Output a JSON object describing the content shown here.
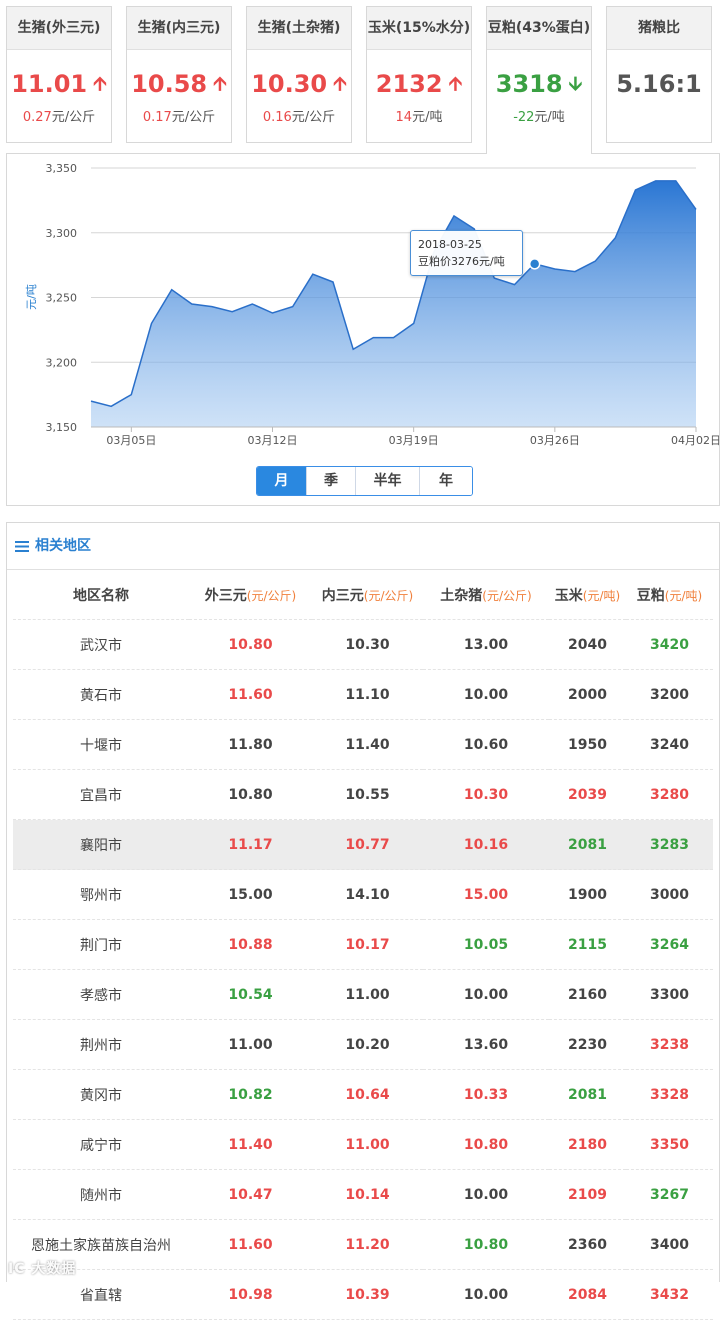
{
  "tabs": [
    {
      "title": "生猪(外三元)",
      "value": "11.01",
      "direction": "up",
      "change": "0.27",
      "unit": "元/公斤",
      "color": "red"
    },
    {
      "title": "生猪(内三元)",
      "value": "10.58",
      "direction": "up",
      "change": "0.17",
      "unit": "元/公斤",
      "color": "red"
    },
    {
      "title": "生猪(土杂猪)",
      "value": "10.30",
      "direction": "up",
      "change": "0.16",
      "unit": "元/公斤",
      "color": "red"
    },
    {
      "title": "玉米(15%水分)",
      "value": "2132",
      "direction": "up",
      "change": "14",
      "unit": "元/吨",
      "color": "red"
    },
    {
      "title": "豆粕(43%蛋白)",
      "value": "3318",
      "direction": "down",
      "change": "-22",
      "unit": "元/吨",
      "color": "green"
    },
    {
      "title": "猪粮比",
      "value": "5.16:1",
      "direction": "",
      "change": "",
      "unit": "",
      "color": "gray"
    }
  ],
  "active_tab": 4,
  "chart_data": {
    "type": "area",
    "ylabel": "元/吨",
    "ylim": [
      3150,
      3350
    ],
    "y_ticks": [
      "3,150",
      "3,200",
      "3,250",
      "3,300",
      "3,350"
    ],
    "x_ticks": [
      "03月05日",
      "03月12日",
      "03月19日",
      "03月26日",
      "04月02日"
    ],
    "x": [
      "2018-03-03",
      "2018-03-04",
      "2018-03-05",
      "2018-03-06",
      "2018-03-07",
      "2018-03-08",
      "2018-03-09",
      "2018-03-10",
      "2018-03-11",
      "2018-03-12",
      "2018-03-13",
      "2018-03-14",
      "2018-03-15",
      "2018-03-16",
      "2018-03-17",
      "2018-03-18",
      "2018-03-19",
      "2018-03-20",
      "2018-03-21",
      "2018-03-22",
      "2018-03-23",
      "2018-03-24",
      "2018-03-25",
      "2018-03-26",
      "2018-03-27",
      "2018-03-28",
      "2018-03-29",
      "2018-03-30",
      "2018-03-31",
      "2018-04-01",
      "2018-04-02"
    ],
    "series": [
      {
        "values": [
          3170,
          3166,
          3175,
          3230,
          3256,
          3245,
          3243,
          3239,
          3245,
          3238,
          3243,
          3268,
          3262,
          3210,
          3219,
          3219,
          3230,
          3285,
          3313,
          3303,
          3265,
          3260,
          3276,
          3272,
          3270,
          3278,
          3296,
          3333,
          3340,
          3340,
          3318
        ]
      }
    ],
    "grid": true,
    "tooltip": {
      "date": "2018-03-25",
      "text": "豆粕价3276元/吨",
      "index": 22
    }
  },
  "range_buttons": [
    "月",
    "季",
    "半年",
    "年"
  ],
  "range_active": 0,
  "section_title": "相关地区",
  "table": {
    "headers": [
      {
        "label": "地区名称",
        "unit": ""
      },
      {
        "label": "外三元",
        "unit": "(元/公斤)"
      },
      {
        "label": "内三元",
        "unit": "(元/公斤)"
      },
      {
        "label": "土杂猪",
        "unit": "(元/公斤)"
      },
      {
        "label": "玉米",
        "unit": "(元/吨)"
      },
      {
        "label": "豆粕",
        "unit": "(元/吨)"
      }
    ],
    "rows": [
      {
        "cells": [
          "武汉市",
          "10.80",
          "10.30",
          "13.00",
          "2040",
          "3420"
        ],
        "colors": [
          "name",
          "red",
          "plain",
          "plain",
          "plain",
          "green"
        ]
      },
      {
        "cells": [
          "黄石市",
          "11.60",
          "11.10",
          "10.00",
          "2000",
          "3200"
        ],
        "colors": [
          "name",
          "red",
          "plain",
          "plain",
          "plain",
          "plain"
        ]
      },
      {
        "cells": [
          "十堰市",
          "11.80",
          "11.40",
          "10.60",
          "1950",
          "3240"
        ],
        "colors": [
          "name",
          "plain",
          "plain",
          "plain",
          "plain",
          "plain"
        ]
      },
      {
        "cells": [
          "宜昌市",
          "10.80",
          "10.55",
          "10.30",
          "2039",
          "3280"
        ],
        "colors": [
          "name",
          "plain",
          "plain",
          "red",
          "red",
          "red"
        ]
      },
      {
        "cells": [
          "襄阳市",
          "11.17",
          "10.77",
          "10.16",
          "2081",
          "3283"
        ],
        "colors": [
          "name",
          "red",
          "red",
          "red",
          "green",
          "green"
        ],
        "highlight": true
      },
      {
        "cells": [
          "鄂州市",
          "15.00",
          "14.10",
          "15.00",
          "1900",
          "3000"
        ],
        "colors": [
          "name",
          "plain",
          "plain",
          "red",
          "plain",
          "plain"
        ]
      },
      {
        "cells": [
          "荆门市",
          "10.88",
          "10.17",
          "10.05",
          "2115",
          "3264"
        ],
        "colors": [
          "name",
          "red",
          "red",
          "green",
          "green",
          "green"
        ]
      },
      {
        "cells": [
          "孝感市",
          "10.54",
          "11.00",
          "10.00",
          "2160",
          "3300"
        ],
        "colors": [
          "name",
          "green",
          "plain",
          "plain",
          "plain",
          "plain"
        ]
      },
      {
        "cells": [
          "荆州市",
          "11.00",
          "10.20",
          "13.60",
          "2230",
          "3238"
        ],
        "colors": [
          "name",
          "plain",
          "plain",
          "plain",
          "plain",
          "red"
        ]
      },
      {
        "cells": [
          "黄冈市",
          "10.82",
          "10.64",
          "10.33",
          "2081",
          "3328"
        ],
        "colors": [
          "name",
          "green",
          "red",
          "red",
          "green",
          "red"
        ]
      },
      {
        "cells": [
          "咸宁市",
          "11.40",
          "11.00",
          "10.80",
          "2180",
          "3350"
        ],
        "colors": [
          "name",
          "red",
          "red",
          "red",
          "red",
          "red"
        ]
      },
      {
        "cells": [
          "随州市",
          "10.47",
          "10.14",
          "10.00",
          "2109",
          "3267"
        ],
        "colors": [
          "name",
          "red",
          "red",
          "plain",
          "red",
          "green"
        ]
      },
      {
        "cells": [
          "恩施土家族苗族自治州",
          "11.60",
          "11.20",
          "10.80",
          "2360",
          "3400"
        ],
        "colors": [
          "name",
          "red",
          "red",
          "green",
          "plain",
          "plain"
        ]
      },
      {
        "cells": [
          "省直辖",
          "10.98",
          "10.39",
          "10.00",
          "2084",
          "3432"
        ],
        "colors": [
          "name",
          "red",
          "red",
          "plain",
          "red",
          "red"
        ]
      }
    ]
  },
  "watermark": "IC 大数据"
}
